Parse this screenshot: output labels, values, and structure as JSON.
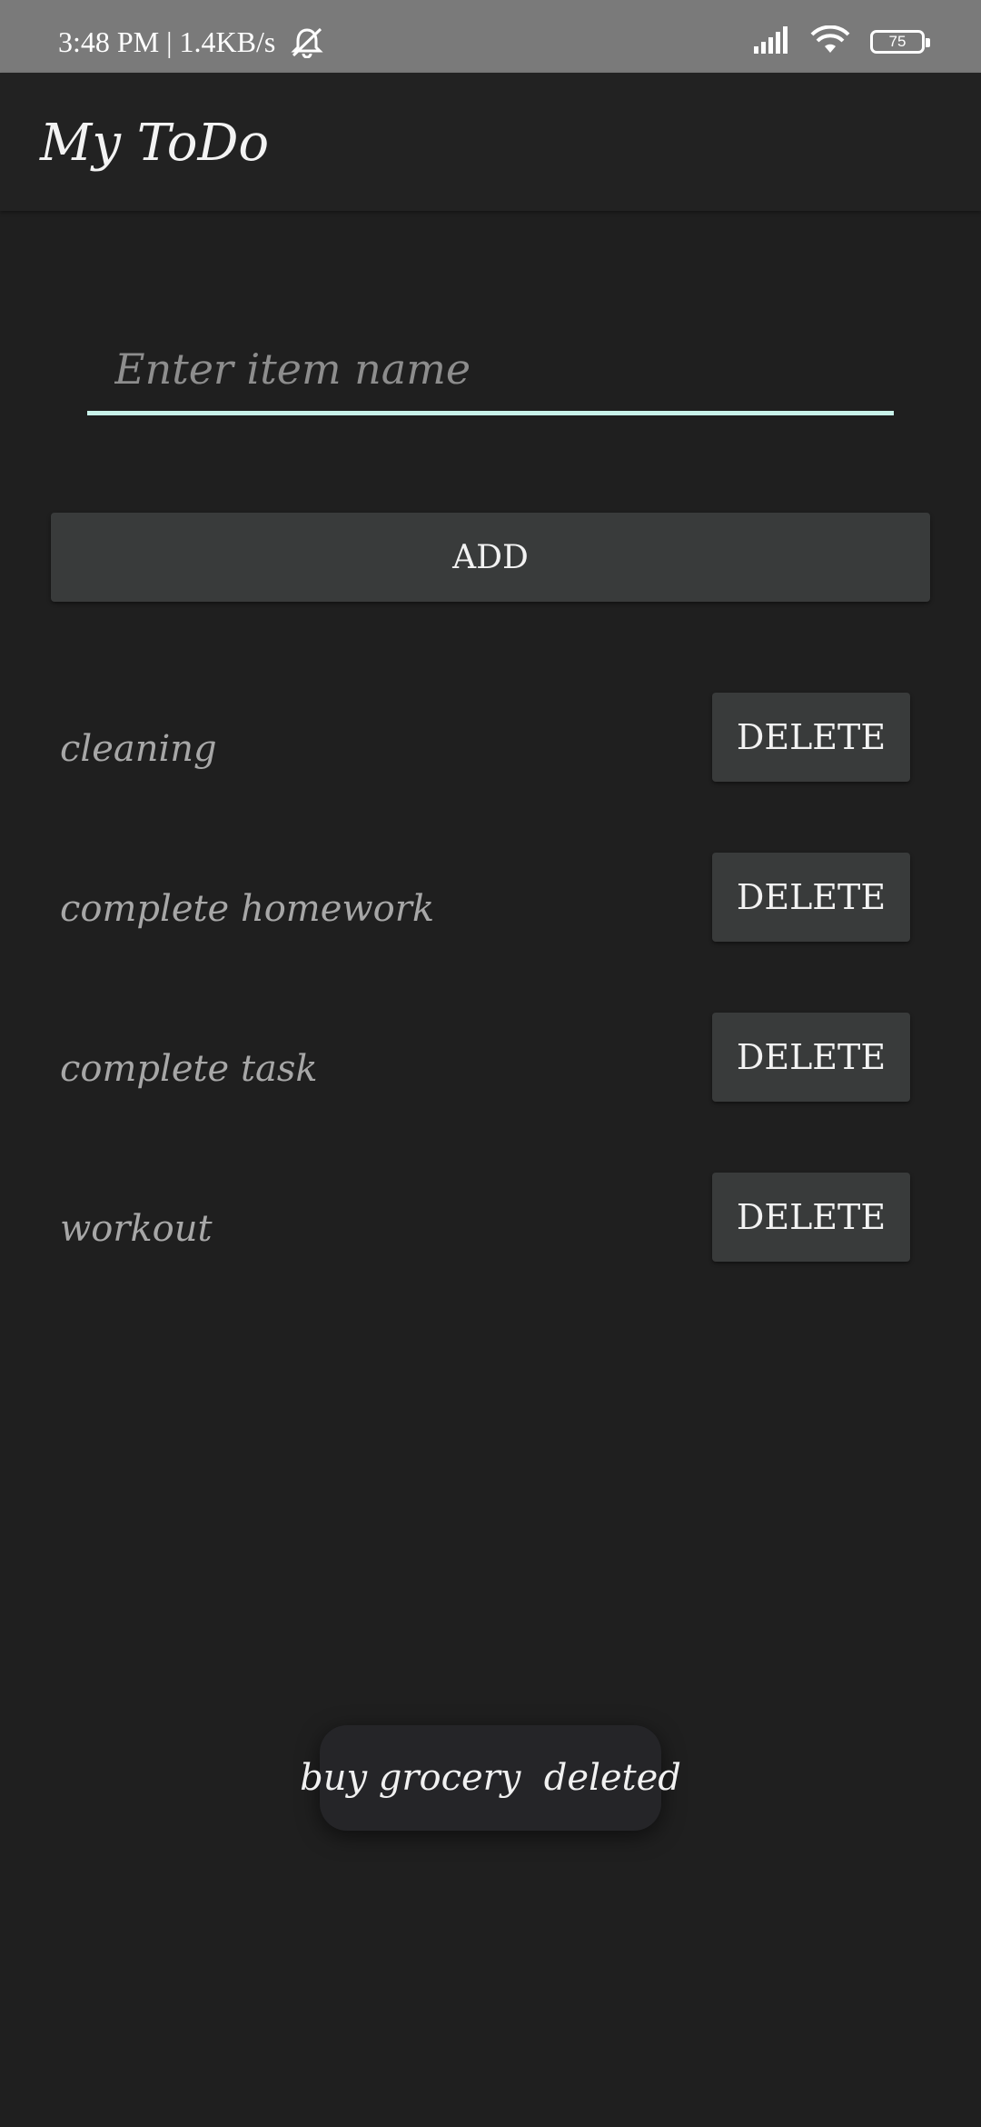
{
  "status_bar": {
    "time": "3:48 PM | 1.4KB/s",
    "icons": [
      "muted-bell-icon",
      "signal-icon",
      "wifi-icon",
      "battery-icon"
    ],
    "battery": "75"
  },
  "app_bar": {
    "title": "My ToDo"
  },
  "input": {
    "placeholder": "Enter item name",
    "value": ""
  },
  "add_button": {
    "label": "ADD"
  },
  "todos": [
    {
      "label": "cleaning",
      "action": "DELETE"
    },
    {
      "label": "complete homework",
      "action": "DELETE"
    },
    {
      "label": "complete task",
      "action": "DELETE"
    },
    {
      "label": "workout",
      "action": "DELETE"
    }
  ],
  "toast": {
    "message": "buy grocery  deleted"
  },
  "colors": {
    "background": "#1f1f1f",
    "app_bar": "#222222",
    "status_bar": "#7a7a7a",
    "button": "#393b3b",
    "input_underline": "#c9f2ea",
    "item_text": "#a7a7a7"
  }
}
